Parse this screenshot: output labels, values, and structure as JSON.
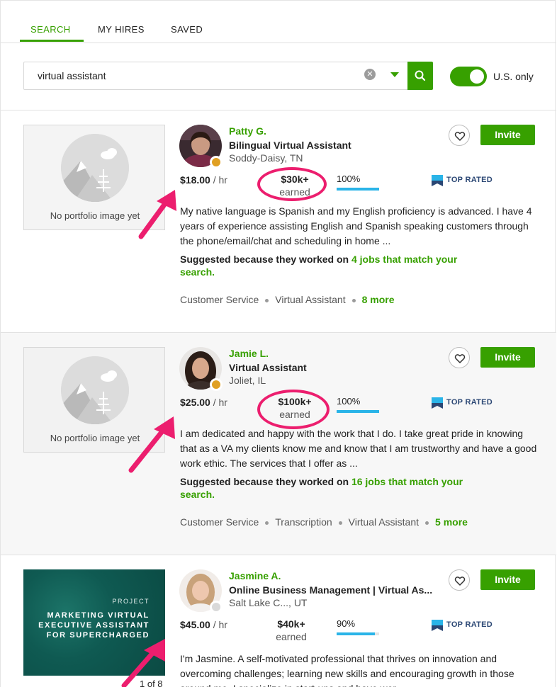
{
  "tabs": [
    {
      "label": "SEARCH",
      "active": true
    },
    {
      "label": "MY HIRES",
      "active": false
    },
    {
      "label": "SAVED",
      "active": false
    }
  ],
  "search": {
    "query": "virtual assistant",
    "toggle_label": "U.S. only",
    "toggle_on": true
  },
  "colors": {
    "brand": "#37a000",
    "annotation": "#ec1e6e",
    "top_rated": "#2b4774",
    "job_success_bar": "#2ab4e8"
  },
  "freelancers": [
    {
      "name": "Patty G.",
      "title": "Bilingual Virtual Assistant",
      "location": "Soddy-Daisy, TN",
      "rate": "$18.00",
      "rate_unit": "/ hr",
      "earned_amount": "$30k+",
      "earned_label": "earned",
      "job_success": "100%",
      "job_success_value": 1.0,
      "badge": "TOP RATED",
      "invite_label": "Invite",
      "portfolio_caption": "No portfolio image yet",
      "description": "My native language is Spanish and my English proficiency is advanced. I have 4 years of experience assisting English and Spanish speaking customers through the phone/email/chat and scheduling in home ...",
      "suggested_prefix": "Suggested because they worked on",
      "suggested_link": "4 jobs that match your search.",
      "skills": [
        "Customer Service",
        "Virtual Assistant"
      ],
      "more": "8 more"
    },
    {
      "name": "Jamie L.",
      "title": "Virtual Assistant",
      "location": "Joliet, IL",
      "rate": "$25.00",
      "rate_unit": "/ hr",
      "earned_amount": "$100k+",
      "earned_label": "earned",
      "job_success": "100%",
      "job_success_value": 1.0,
      "badge": "TOP RATED",
      "invite_label": "Invite",
      "portfolio_caption": "No portfolio image yet",
      "description": "I am dedicated and happy with the work that I do. I take great pride in knowing that as a VA my clients know me and know that I am trustworthy and have a good work ethic. The services that I offer as ...",
      "suggested_prefix": "Suggested because they worked on",
      "suggested_link": "16 jobs that match your search.",
      "skills": [
        "Customer Service",
        "Transcription",
        "Virtual Assistant"
      ],
      "more": "5 more"
    },
    {
      "name": "Jasmine A.",
      "title": "Online Business Management | Virtual As...",
      "location": "Salt Lake C..., UT",
      "rate": "$45.00",
      "rate_unit": "/ hr",
      "earned_amount": "$40k+",
      "earned_label": "earned",
      "job_success": "90%",
      "job_success_value": 0.9,
      "badge": "TOP RATED",
      "invite_label": "Invite",
      "project_tag": "PROJECT",
      "project_title": "MARKETING VIRTUAL EXECUTIVE ASSISTANT FOR SUPERCHARGED",
      "page_count": "1 of 8",
      "description": "I'm Jasmine. A self-motivated professional that thrives on innovation and overcoming challenges; learning new skills and encouraging growth in those around me. I specialize in start-ups and have wor..."
    }
  ]
}
